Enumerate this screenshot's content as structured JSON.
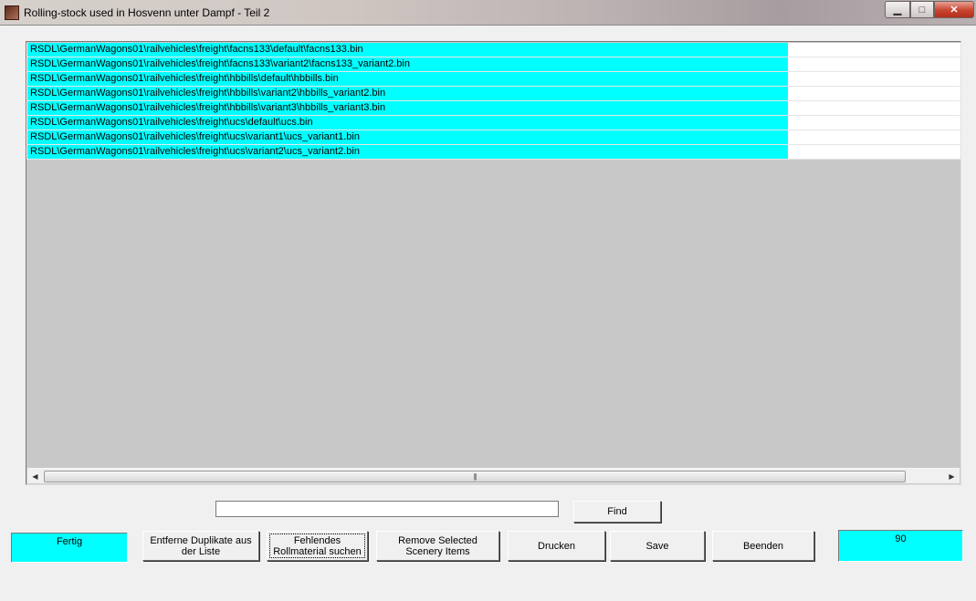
{
  "window": {
    "title": "Rolling-stock used in Hosvenn unter Dampf - Teil 2",
    "buttons": {
      "minimize": "▁",
      "maximize": "□",
      "close": "✕"
    }
  },
  "list": {
    "rows": [
      "RSDL\\GermanWagons01\\railvehicles\\freight\\facns133\\default\\facns133.bin",
      "RSDL\\GermanWagons01\\railvehicles\\freight\\facns133\\variant2\\facns133_variant2.bin",
      "RSDL\\GermanWagons01\\railvehicles\\freight\\hbbills\\default\\hbbills.bin",
      "RSDL\\GermanWagons01\\railvehicles\\freight\\hbbills\\variant2\\hbbills_variant2.bin",
      "RSDL\\GermanWagons01\\railvehicles\\freight\\hbbills\\variant3\\hbbills_variant3.bin",
      "RSDL\\GermanWagons01\\railvehicles\\freight\\ucs\\default\\ucs.bin",
      "RSDL\\GermanWagons01\\railvehicles\\freight\\ucs\\variant1\\ucs_variant1.bin",
      "RSDL\\GermanWagons01\\railvehicles\\freight\\ucs\\variant2\\ucs_variant2.bin"
    ],
    "highlight_color": "#00ffff"
  },
  "search": {
    "value": "",
    "find_label": "Find"
  },
  "buttons": {
    "dedupe": "Entferne Duplikate aus der Liste",
    "missing": "Fehlendes Rollmaterial suchen",
    "remove": "Remove Selected Scenery Items",
    "print": "Drucken",
    "save": "Save",
    "exit": "Beenden"
  },
  "status": {
    "left": "Fertig",
    "right": "90"
  }
}
